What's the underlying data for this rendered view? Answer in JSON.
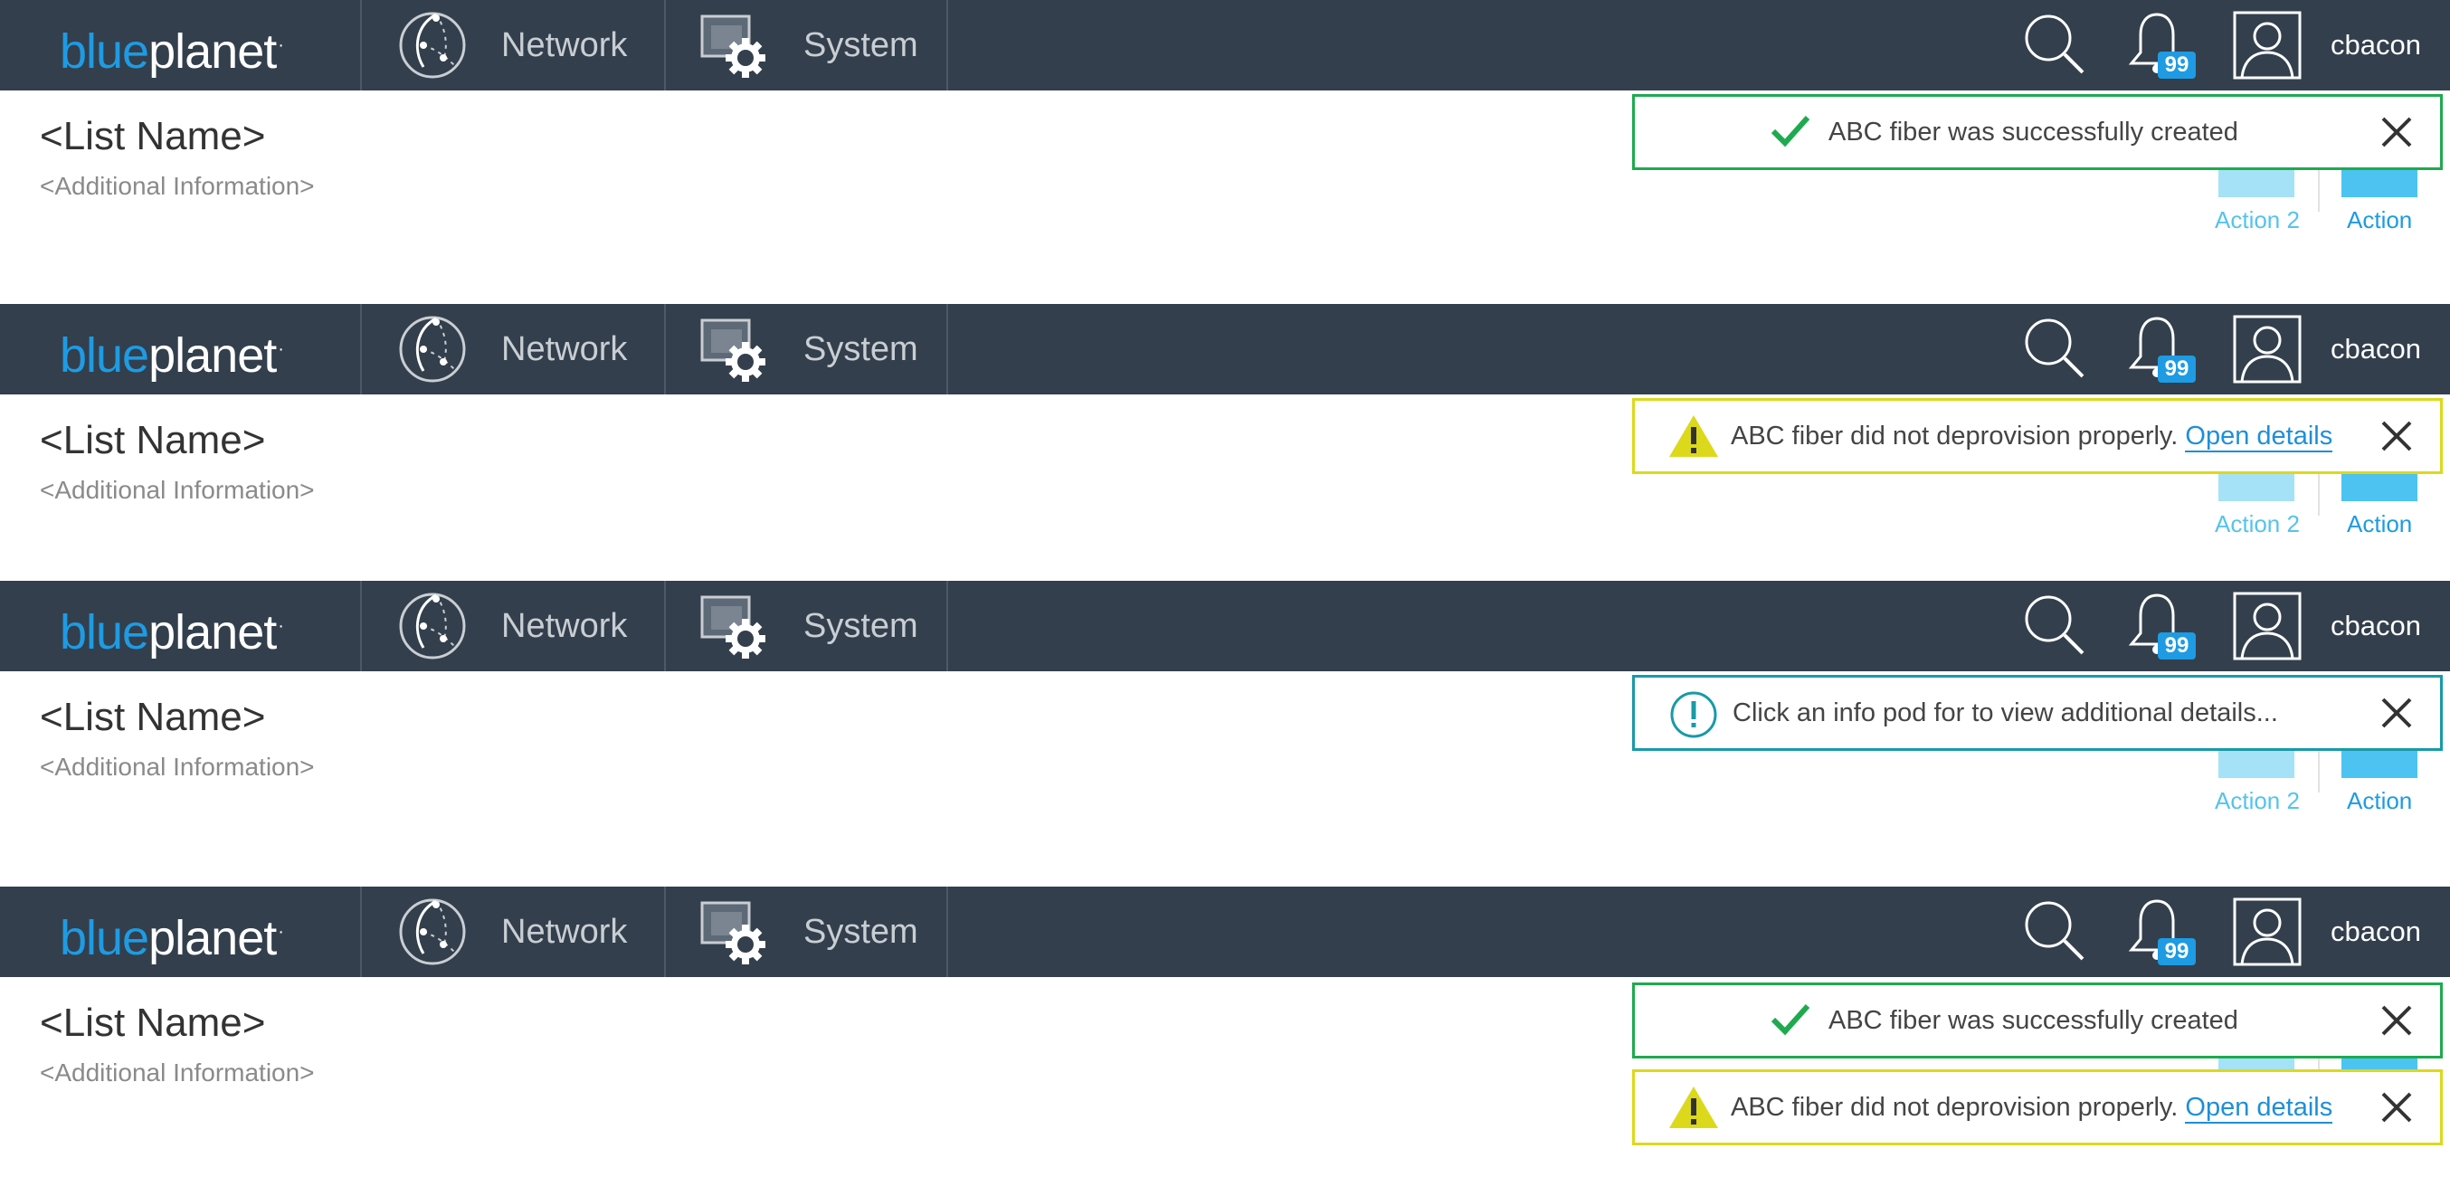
{
  "header": {
    "logo_blue": "blue",
    "logo_planet": "planet",
    "logo_mark": "·",
    "nav": [
      {
        "label": "Network",
        "icon": "network-globe-icon"
      },
      {
        "label": "System",
        "icon": "system-gear-icon"
      }
    ],
    "right_icons": [
      "search-icon",
      "bell-icon",
      "user-avatar-icon"
    ],
    "notification_count": "99",
    "username": "cbacon"
  },
  "page": {
    "title": "<List Name>",
    "subtitle": "<Additional Information>",
    "action2_label": "Action 2",
    "action_label": "Action"
  },
  "toasts": {
    "success": {
      "message": "ABC fiber was successfully created",
      "icon": "checkmark-icon",
      "color": "#1eaa4f"
    },
    "warning": {
      "message": "ABC fiber did not deprovision properly.",
      "link": "Open details",
      "icon": "warning-triangle-icon",
      "color": "#dcd91c"
    },
    "info": {
      "message": "Click an info pod for to view additional details...",
      "icon": "info-circle-icon",
      "color": "#189aa8"
    }
  },
  "colors": {
    "header_bg": "#333f4c",
    "brand_blue": "#1e9be3",
    "action_light": "#a5e2f7",
    "action_dark": "#4cc3f1"
  }
}
